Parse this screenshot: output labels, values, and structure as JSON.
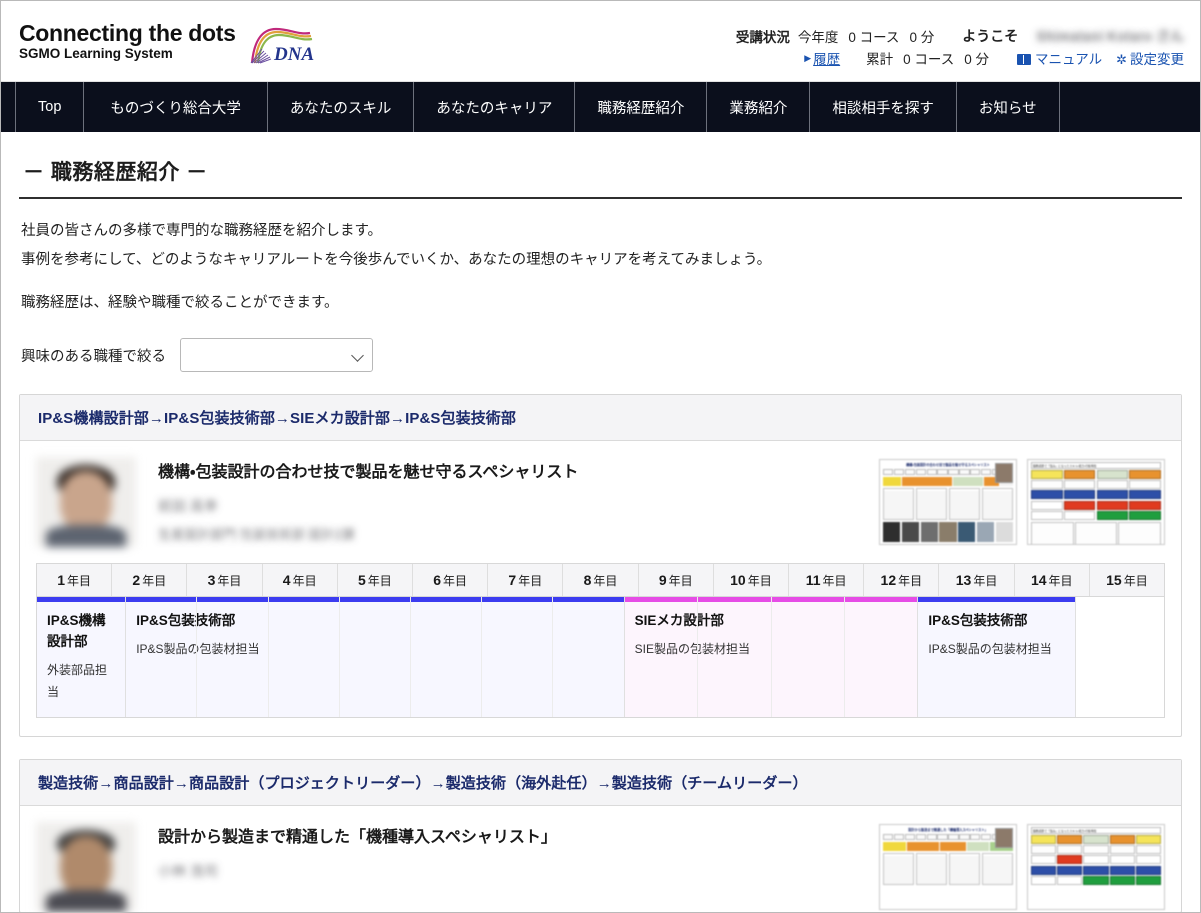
{
  "header": {
    "brand_line1": "Connecting the dots",
    "brand_line2": "SGMO Learning System",
    "logo_text": "DNA",
    "status_label": "受講状況",
    "status_period_year": "今年度",
    "status_year_courses": "0 コース",
    "status_year_minutes": "0 分",
    "history_link": "履歴",
    "status_period_total": "累計",
    "status_total_courses": "0 コース",
    "status_total_minutes": "0 分",
    "welcome_label": "ようこそ",
    "welcome_user": "Shimatani Kotaro さん",
    "manual_link": "マニュアル",
    "settings_link": "設定変更"
  },
  "nav": {
    "items": [
      {
        "label": "Top",
        "name": "nav-top"
      },
      {
        "label": "ものづくり総合大学",
        "name": "nav-monozukuri"
      },
      {
        "label": "あなたのスキル",
        "name": "nav-your-skill"
      },
      {
        "label": "あなたのキャリア",
        "name": "nav-your-career"
      },
      {
        "label": "職務経歴紹介",
        "name": "nav-career-history"
      },
      {
        "label": "業務紹介",
        "name": "nav-job-intro"
      },
      {
        "label": "相談相手を探す",
        "name": "nav-find-advisor"
      },
      {
        "label": "お知らせ",
        "name": "nav-notices"
      }
    ]
  },
  "main": {
    "page_title": "－ 職務経歴紹介 －",
    "desc_line1": "社員の皆さんの多様で専門的な職務経歴を紹介します。",
    "desc_line2": "事例を参考にして、どのようなキャリアルートを今後歩んでいくか、あなたの理想のキャリアを考えてみましょう。",
    "desc_line3": "職務経歴は、経験や職種で絞ることができます。",
    "filter_label": "興味のある職種で絞る",
    "filter_value": "",
    "filter_placeholder": ""
  },
  "colors": {
    "nav_bg": "#0b0f1c",
    "card_title": "#1b2a6b",
    "link": "#1a53b0",
    "segment_blue": "#3c3cf0",
    "segment_pink": "#e64ce6",
    "segment_blue_bg": "#f7f7ff",
    "segment_pink_bg": "#fdf5fd"
  },
  "timeline_years": [
    {
      "num": "1",
      "unit": "年目"
    },
    {
      "num": "2",
      "unit": "年目"
    },
    {
      "num": "3",
      "unit": "年目"
    },
    {
      "num": "4",
      "unit": "年目"
    },
    {
      "num": "5",
      "unit": "年目"
    },
    {
      "num": "6",
      "unit": "年目"
    },
    {
      "num": "7",
      "unit": "年目"
    },
    {
      "num": "8",
      "unit": "年目"
    },
    {
      "num": "9",
      "unit": "年目"
    },
    {
      "num": "10",
      "unit": "年目"
    },
    {
      "num": "11",
      "unit": "年目"
    },
    {
      "num": "12",
      "unit": "年目"
    },
    {
      "num": "13",
      "unit": "年目"
    },
    {
      "num": "14",
      "unit": "年目"
    },
    {
      "num": "15",
      "unit": "年目"
    }
  ],
  "cards": [
    {
      "route_title": "IP&S機構設計部→IP&S包装技術部→SIEメカ設計部→IP&S包装技術部",
      "profile_title": "機構・包装設計の合わせ技で製品を魅せ守るスペシャリスト",
      "profile_name": "前田 高幸",
      "profile_dept": "生産設計部門 包装技術部 設計2課",
      "thumb1_title": "機構・包装設計の合わせ技で製品を魅せ守るスペシャリスト",
      "thumb2_title": "職務経歴で「強み」になったスキル・能力・行動特性",
      "segments": [
        {
          "span": 1,
          "title": "IP&S機構設計部",
          "desc": "外装部品担当",
          "color": "blue"
        },
        {
          "span": 7,
          "title": "IP&S包装技術部",
          "desc": "IP&S製品の包装材担当",
          "color": "blue"
        },
        {
          "span": 4,
          "title": "SIEメカ設計部",
          "desc": "SIE製品の包装材担当",
          "color": "pink"
        },
        {
          "span": 2,
          "title": "IP&S包装技術部",
          "desc": "IP&S製品の包装材担当",
          "color": "blue"
        },
        {
          "span": 1,
          "title": "",
          "desc": "",
          "color": "none"
        }
      ]
    },
    {
      "route_title": "製造技術→商品設計→商品設計（プロジェクトリーダー）→製造技術（海外赴任）→製造技術（チームリーダー）",
      "profile_title": "設計から製造まで精通した「機種導入スペシャリスト」",
      "profile_name": "小林 浩司",
      "profile_dept": "",
      "thumb1_title": "設計から製造まで精通した「機種導入スペシャリスト」",
      "thumb2_title": "職務経歴で「強み」になったスキル・能力・行動特性",
      "segments": []
    }
  ]
}
